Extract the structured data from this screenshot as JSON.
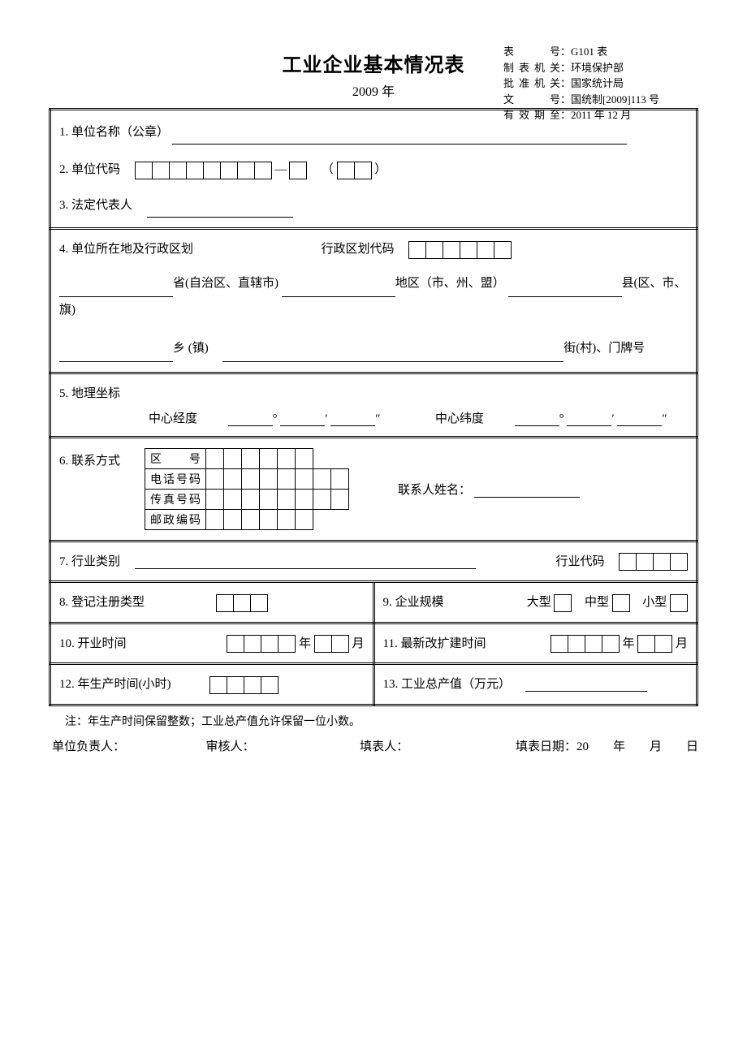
{
  "title": "工业企业基本情况表",
  "year": "2009 年",
  "meta": {
    "r1_label": "表　　号",
    "r1_value": "G101 表",
    "r2_label": "制表机关",
    "r2_value": "环境保护部",
    "r3_label": "批准机关",
    "r3_value": "国家统计局",
    "r4_label": "文　　号",
    "r4_value": "国统制[2009]113 号",
    "r5_label": "有效期至",
    "r5_value": "2011 年 12 月"
  },
  "f1": "1. 单位名称（公章）",
  "f2": "2. 单位代码",
  "f3": "3. 法定代表人",
  "f4": "4. 单位所在地及行政区划",
  "f4_code": "行政区划代码",
  "f4_l1a": "省(自治区、直辖市)",
  "f4_l1b": "地区（市、州、盟）",
  "f4_l1c": "县(区、市、旗)",
  "f4_l2a": "乡 (镇)",
  "f4_l2b": "街(村)、门牌号",
  "f5": "5. 地理坐标",
  "f5_lng": "中心经度",
  "f5_lat": "中心纬度",
  "deg": "°",
  "min": "′",
  "sec": "″",
  "f6": "6. 联系方式",
  "f6_area": "区　　号",
  "f6_tel": "电话号码",
  "f6_fax": "传真号码",
  "f6_zip": "邮政编码",
  "f6_contact": "联系人姓名：",
  "f7": "7. 行业类别",
  "f7_code": "行业代码",
  "f8": "8. 登记注册类型",
  "f9": "9. 企业规模",
  "f9_large": "大型",
  "f9_medium": "中型",
  "f9_small": "小型",
  "f10": "10. 开业时间",
  "f10_y": "年",
  "f10_m": "月",
  "f11": "11. 最新改扩建时间",
  "f12": "12. 年生产时间(小时)",
  "f13": "13. 工业总产值（万元）",
  "footnote": "注：年生产时间保留整数；工业总产值允许保留一位小数。",
  "sign_owner": "单位负责人：",
  "sign_review": "审核人：",
  "sign_fill": "填表人：",
  "sign_date": "填表日期：20　　年　　月　　日"
}
